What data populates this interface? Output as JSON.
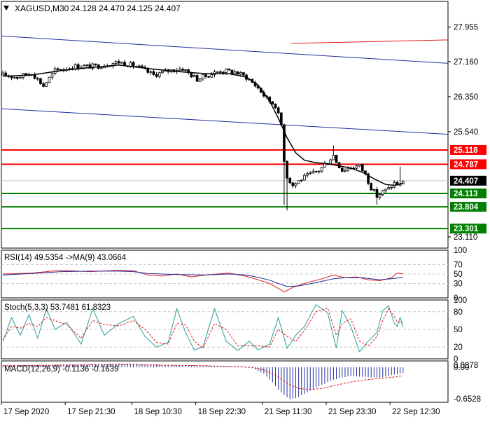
{
  "header": {
    "symbol_tf": "XAGUSD,M30",
    "ohlc": "24.128 24.470 24.125 24.407",
    "menu_icon": "triangle-down-icon"
  },
  "colors": {
    "frame": "#000000",
    "grid": "#c8c8c8",
    "candle": "#000000",
    "ma": "#000000",
    "channel_blue": "#1f2f9e",
    "channel_red": "#e41b1b",
    "resistance": "#ff0000",
    "support": "#008000",
    "price_tag": "#000000",
    "rsi_line": "#e41b1b",
    "rsi_ma": "#1f2f9e",
    "stoch_main": "#2a9d9d",
    "stoch_signal": "#e41b1b",
    "macd_hist": "#1f2f9e",
    "macd_signal": "#e41b1b",
    "text": "#000000"
  },
  "chart_data": [
    {
      "id": "price",
      "type": "line",
      "title": "XAGUSD,M30",
      "ylim": [
        22.85,
        28.55
      ],
      "y_ticks": [
        "27.955",
        "27.160",
        "26.350",
        "25.540",
        "23.110"
      ],
      "current_price": {
        "value": 24.407,
        "label": "24.407"
      },
      "levels": [
        {
          "name": "resistance-1",
          "value": 25.118,
          "label": "25.118",
          "kind": "resistance"
        },
        {
          "name": "resistance-2",
          "value": 24.787,
          "label": "24.787",
          "kind": "resistance"
        },
        {
          "name": "support-1",
          "value": 24.113,
          "label": "24.113",
          "kind": "support"
        },
        {
          "name": "support-2",
          "value": 23.804,
          "label": "23.804",
          "kind": "support"
        },
        {
          "name": "support-3",
          "value": 23.301,
          "label": "23.301",
          "kind": "support"
        }
      ],
      "channel": {
        "upper": {
          "x0": 0,
          "y0": 27.75,
          "x1": 154,
          "y1": 27.12
        },
        "lower": {
          "x0": 0,
          "y0": 26.07,
          "x1": 154,
          "y1": 25.48
        },
        "top": {
          "x0": 100,
          "y0": 27.58,
          "x1": 154,
          "y1": 27.66
        }
      },
      "x_labels": [
        {
          "index": 0,
          "label": "17 Sep 2020"
        },
        {
          "index": 22,
          "label": "17 Sep 21:30"
        },
        {
          "index": 45,
          "label": "18 Sep 10:30"
        },
        {
          "index": 67,
          "label": "18 Sep 22:30"
        },
        {
          "index": 90,
          "label": "21 Sep 11:30"
        },
        {
          "index": 112,
          "label": "21 Sep 23:30"
        },
        {
          "index": 134,
          "label": "22 Sep 12:30"
        }
      ],
      "anchors": [
        [
          0,
          26.85
        ],
        [
          5,
          26.8
        ],
        [
          10,
          26.9
        ],
        [
          14,
          26.6
        ],
        [
          18,
          26.95
        ],
        [
          25,
          27.05
        ],
        [
          32,
          27.05
        ],
        [
          40,
          27.15
        ],
        [
          46,
          27.05
        ],
        [
          52,
          26.85
        ],
        [
          57,
          26.95
        ],
        [
          62,
          27.0
        ],
        [
          67,
          26.75
        ],
        [
          71,
          26.85
        ],
        [
          75,
          26.95
        ],
        [
          80,
          26.92
        ],
        [
          84,
          26.8
        ],
        [
          88,
          26.55
        ],
        [
          91,
          26.3
        ],
        [
          94,
          26.15
        ],
        [
          96,
          25.7
        ],
        [
          97,
          24.9
        ],
        [
          98,
          24.5
        ],
        [
          100,
          24.3
        ],
        [
          103,
          24.45
        ],
        [
          106,
          24.55
        ],
        [
          109,
          24.65
        ],
        [
          112,
          24.85
        ],
        [
          114,
          25.0
        ],
        [
          115,
          24.85
        ],
        [
          117,
          24.65
        ],
        [
          120,
          24.72
        ],
        [
          123,
          24.75
        ],
        [
          125,
          24.55
        ],
        [
          127,
          24.25
        ],
        [
          129,
          24.05
        ],
        [
          131,
          24.15
        ],
        [
          133,
          24.22
        ],
        [
          135,
          24.35
        ],
        [
          137,
          24.3
        ],
        [
          138,
          24.41
        ]
      ],
      "ma_points": [
        [
          0,
          26.82
        ],
        [
          10,
          26.85
        ],
        [
          20,
          26.95
        ],
        [
          30,
          27.02
        ],
        [
          40,
          27.08
        ],
        [
          50,
          27.0
        ],
        [
          60,
          26.93
        ],
        [
          70,
          26.88
        ],
        [
          78,
          26.88
        ],
        [
          84,
          26.8
        ],
        [
          88,
          26.62
        ],
        [
          92,
          26.25
        ],
        [
          95,
          25.85
        ],
        [
          98,
          25.4
        ],
        [
          101,
          25.05
        ],
        [
          104,
          24.88
        ],
        [
          108,
          24.82
        ],
        [
          112,
          24.8
        ],
        [
          116,
          24.75
        ],
        [
          120,
          24.7
        ],
        [
          124,
          24.6
        ],
        [
          128,
          24.45
        ],
        [
          132,
          24.32
        ],
        [
          135,
          24.3
        ],
        [
          138,
          24.35
        ]
      ]
    },
    {
      "id": "rsi",
      "type": "line",
      "title": "RSI(14) 49.5354  ->MA(9) 43.0664",
      "ylim": [
        0,
        100
      ],
      "y_ticks": [
        "100",
        "70",
        "50",
        "30",
        "0"
      ],
      "levels": [
        70,
        50,
        30
      ],
      "series": [
        {
          "name": "RSI(14)",
          "points": [
            [
              0,
              50
            ],
            [
              10,
              52
            ],
            [
              20,
              58
            ],
            [
              30,
              55
            ],
            [
              40,
              58
            ],
            [
              45,
              57
            ],
            [
              50,
              48
            ],
            [
              55,
              46
            ],
            [
              60,
              50
            ],
            [
              65,
              44
            ],
            [
              70,
              48
            ],
            [
              78,
              52
            ],
            [
              84,
              45
            ],
            [
              88,
              38
            ],
            [
              92,
              30
            ],
            [
              95,
              20
            ],
            [
              97,
              12
            ],
            [
              100,
              22
            ],
            [
              105,
              32
            ],
            [
              110,
              40
            ],
            [
              114,
              48
            ],
            [
              118,
              42
            ],
            [
              122,
              44
            ],
            [
              126,
              38
            ],
            [
              130,
              36
            ],
            [
              134,
              42
            ],
            [
              136,
              52
            ],
            [
              138,
              50
            ]
          ]
        },
        {
          "name": "MA(9)",
          "points": [
            [
              0,
              48
            ],
            [
              10,
              51
            ],
            [
              20,
              55
            ],
            [
              30,
              56
            ],
            [
              40,
              56
            ],
            [
              45,
              55
            ],
            [
              50,
              51
            ],
            [
              60,
              49
            ],
            [
              70,
              48
            ],
            [
              78,
              50
            ],
            [
              84,
              48
            ],
            [
              88,
              43
            ],
            [
              92,
              37
            ],
            [
              95,
              30
            ],
            [
              98,
              24
            ],
            [
              102,
              25
            ],
            [
              108,
              32
            ],
            [
              114,
              40
            ],
            [
              118,
              42
            ],
            [
              124,
              42
            ],
            [
              130,
              38
            ],
            [
              134,
              40
            ],
            [
              138,
              43
            ]
          ]
        }
      ]
    },
    {
      "id": "stoch",
      "type": "line",
      "title": "Stoch(5,3,3) 53.7481 61.8323",
      "ylim": [
        0,
        100
      ],
      "y_ticks": [
        "100",
        "80",
        "50",
        "20",
        "0"
      ],
      "levels": [
        80,
        50,
        20
      ],
      "series": [
        {
          "name": "main",
          "points": [
            [
              0,
              30
            ],
            [
              3,
              70
            ],
            [
              6,
              40
            ],
            [
              9,
              75
            ],
            [
              12,
              35
            ],
            [
              15,
              85
            ],
            [
              18,
              50
            ],
            [
              22,
              62
            ],
            [
              27,
              25
            ],
            [
              31,
              85
            ],
            [
              35,
              40
            ],
            [
              40,
              60
            ],
            [
              45,
              72
            ],
            [
              49,
              38
            ],
            [
              53,
              20
            ],
            [
              57,
              28
            ],
            [
              60,
              85
            ],
            [
              63,
              45
            ],
            [
              66,
              15
            ],
            [
              69,
              20
            ],
            [
              73,
              85
            ],
            [
              77,
              30
            ],
            [
              81,
              14
            ],
            [
              85,
              30
            ],
            [
              88,
              15
            ],
            [
              92,
              25
            ],
            [
              95,
              70
            ],
            [
              98,
              18
            ],
            [
              101,
              40
            ],
            [
              104,
              55
            ],
            [
              108,
              92
            ],
            [
              112,
              78
            ],
            [
              115,
              18
            ],
            [
              117,
              82
            ],
            [
              120,
              55
            ],
            [
              123,
              12
            ],
            [
              126,
              30
            ],
            [
              129,
              45
            ],
            [
              131,
              82
            ],
            [
              133,
              90
            ],
            [
              135,
              60
            ],
            [
              136,
              55
            ],
            [
              137,
              70
            ],
            [
              138,
              54
            ]
          ]
        },
        {
          "name": "signal",
          "points": [
            [
              0,
              32
            ],
            [
              3,
              55
            ],
            [
              6,
              52
            ],
            [
              9,
              60
            ],
            [
              12,
              55
            ],
            [
              15,
              70
            ],
            [
              18,
              65
            ],
            [
              22,
              58
            ],
            [
              27,
              35
            ],
            [
              31,
              65
            ],
            [
              35,
              58
            ],
            [
              40,
              56
            ],
            [
              45,
              65
            ],
            [
              49,
              50
            ],
            [
              53,
              28
            ],
            [
              57,
              25
            ],
            [
              60,
              60
            ],
            [
              63,
              58
            ],
            [
              66,
              30
            ],
            [
              69,
              18
            ],
            [
              73,
              60
            ],
            [
              77,
              50
            ],
            [
              81,
              22
            ],
            [
              85,
              22
            ],
            [
              88,
              22
            ],
            [
              92,
              20
            ],
            [
              95,
              50
            ],
            [
              98,
              38
            ],
            [
              101,
              30
            ],
            [
              104,
              48
            ],
            [
              108,
              80
            ],
            [
              112,
              86
            ],
            [
              115,
              40
            ],
            [
              117,
              60
            ],
            [
              120,
              68
            ],
            [
              123,
              30
            ],
            [
              126,
              22
            ],
            [
              129,
              38
            ],
            [
              131,
              65
            ],
            [
              133,
              85
            ],
            [
              135,
              72
            ],
            [
              136,
              62
            ],
            [
              137,
              62
            ],
            [
              138,
              62
            ]
          ]
        }
      ]
    },
    {
      "id": "macd",
      "type": "bar",
      "title": "MACD(12,26,9) -0.1136 -0.1639",
      "ylim": [
        -0.66,
        0.12
      ],
      "y_ticks": [
        "0.0878",
        "0.00",
        "-0.6528"
      ],
      "series": [
        {
          "name": "histogram",
          "points": [
            [
              0,
              0.03
            ],
            [
              20,
              0.05
            ],
            [
              40,
              0.07
            ],
            [
              50,
              0.06
            ],
            [
              60,
              0.04
            ],
            [
              70,
              0.03
            ],
            [
              80,
              0.02
            ],
            [
              86,
              -0.02
            ],
            [
              90,
              -0.12
            ],
            [
              93,
              -0.28
            ],
            [
              95,
              -0.42
            ],
            [
              97,
              -0.52
            ],
            [
              99,
              -0.6
            ],
            [
              101,
              -0.58
            ],
            [
              104,
              -0.5
            ],
            [
              108,
              -0.38
            ],
            [
              112,
              -0.28
            ],
            [
              116,
              -0.2
            ],
            [
              120,
              -0.16
            ],
            [
              125,
              -0.18
            ],
            [
              130,
              -0.2
            ],
            [
              134,
              -0.15
            ],
            [
              138,
              -0.11
            ]
          ]
        },
        {
          "name": "signal",
          "points": [
            [
              0,
              0.03
            ],
            [
              40,
              0.05
            ],
            [
              70,
              0.03
            ],
            [
              86,
              0.0
            ],
            [
              90,
              -0.05
            ],
            [
              94,
              -0.15
            ],
            [
              98,
              -0.3
            ],
            [
              102,
              -0.4
            ],
            [
              106,
              -0.42
            ],
            [
              110,
              -0.4
            ],
            [
              114,
              -0.35
            ],
            [
              118,
              -0.3
            ],
            [
              122,
              -0.26
            ],
            [
              126,
              -0.23
            ],
            [
              130,
              -0.21
            ],
            [
              134,
              -0.19
            ],
            [
              138,
              -0.16
            ]
          ]
        }
      ]
    }
  ]
}
